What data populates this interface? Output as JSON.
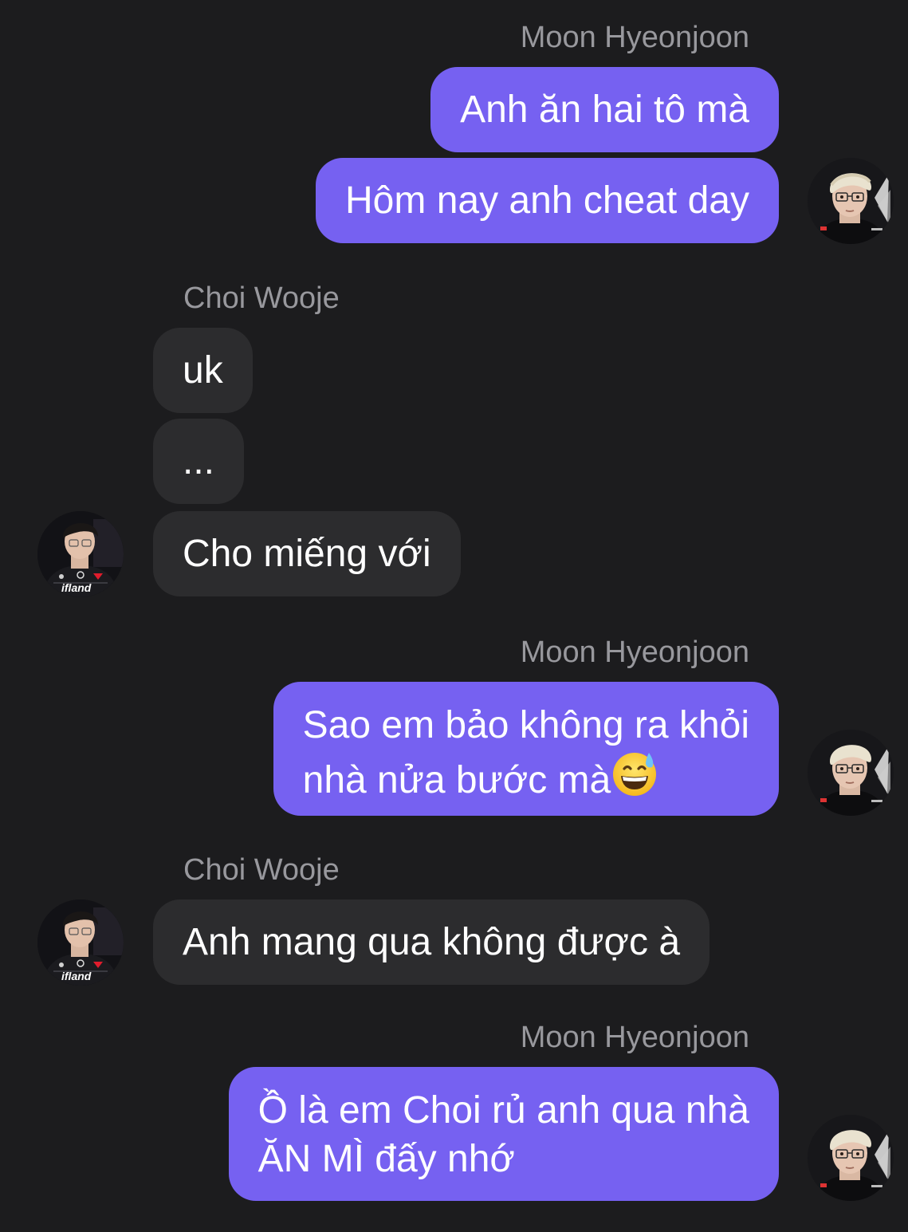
{
  "conversation": {
    "groups": [
      {
        "sender": "Moon Hyeonjoon",
        "side": "outgoing",
        "messages": [
          "Anh ăn hai tô mà",
          "Hôm nay anh cheat day"
        ]
      },
      {
        "sender": "Choi Wooje",
        "side": "incoming",
        "messages": [
          "uk",
          "...",
          "Cho miếng với"
        ]
      },
      {
        "sender": "Moon Hyeonjoon",
        "side": "outgoing",
        "messages": [
          {
            "line1": "Sao em bảo không ra khỏi",
            "line2": "nhà nửa bước mà",
            "emoji": "grinning-face-with-sweat"
          }
        ]
      },
      {
        "sender": "Choi Wooje",
        "side": "incoming",
        "messages": [
          "Anh mang qua không được à"
        ]
      },
      {
        "sender": "Moon Hyeonjoon",
        "side": "outgoing",
        "messages": [
          {
            "line1": "Ồ là em Choi rủ anh qua nhà",
            "line2": "ĂN MÌ đấy nhớ"
          }
        ]
      }
    ]
  },
  "avatars": {
    "choi_badge_text": "ifland"
  },
  "colors": {
    "background": "#1c1c1e",
    "outgoing_bubble": "#7661f1",
    "incoming_bubble": "#2c2c2e",
    "sender_name": "#98989d",
    "message_text": "#ffffff"
  }
}
